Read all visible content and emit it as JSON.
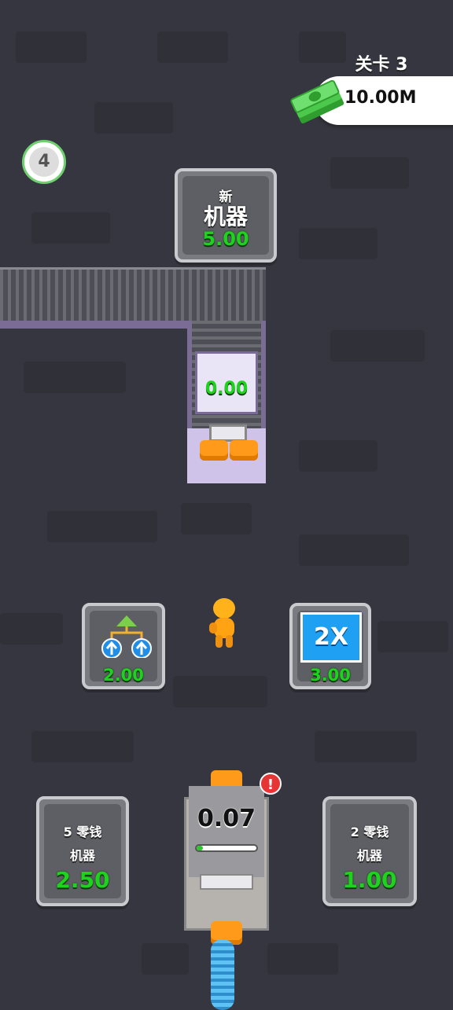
{
  "hud": {
    "level_label": "关卡 3",
    "money": "10.00M",
    "level_badge": "4"
  },
  "new_machine_pad": {
    "line1": "新",
    "line2": "机器",
    "price": "5.00"
  },
  "press": {
    "value": "0.00"
  },
  "upgrade_pad": {
    "price": "2.00",
    "icon": "upgrade-arrows-icon"
  },
  "double_pad": {
    "label": "2X",
    "price": "3.00"
  },
  "change_machine_5": {
    "line1": "5 零钱",
    "line2": "机器",
    "price": "2.50"
  },
  "change_machine_2": {
    "line1": "2 零钱",
    "line2": "机器",
    "price": "1.00"
  },
  "change_machine": {
    "value": "0.07",
    "progress": 0.1,
    "alert": "!"
  },
  "colors": {
    "background": "#35363f",
    "price_green": "#1ed31e",
    "accent_orange": "#ff9a1a",
    "conveyor_purple": "#7b6c96"
  }
}
